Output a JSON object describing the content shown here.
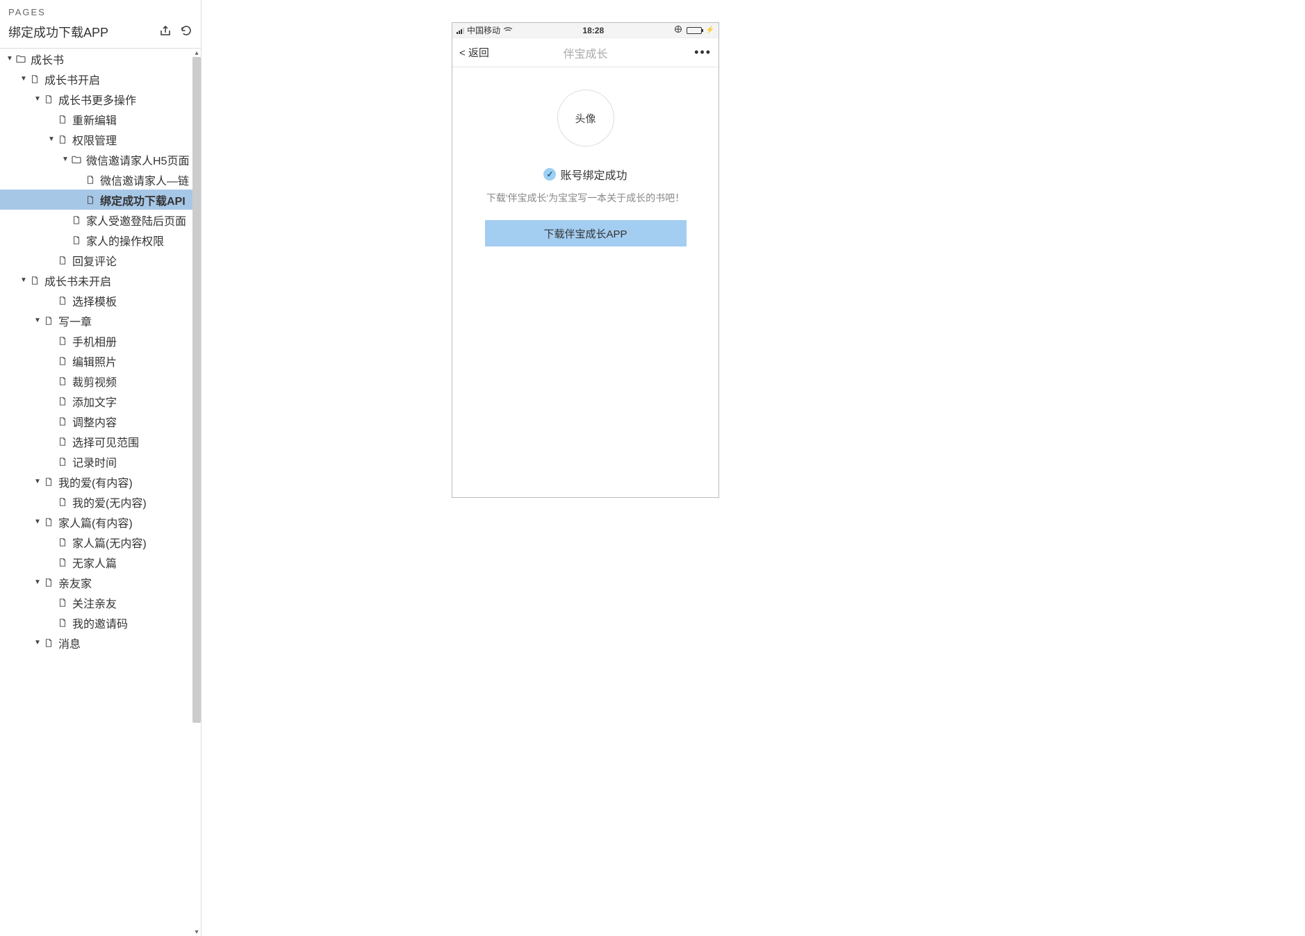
{
  "sidebar": {
    "header_label": "PAGES",
    "title": "绑定成功下载APP",
    "tree": [
      {
        "indent": 0,
        "chev": true,
        "icon": "folder",
        "label": "成长书"
      },
      {
        "indent": 1,
        "chev": true,
        "icon": "page",
        "label": "成长书开启"
      },
      {
        "indent": 2,
        "chev": true,
        "icon": "page",
        "label": "成长书更多操作"
      },
      {
        "indent": 3,
        "chev": false,
        "icon": "page",
        "label": "重新编辑"
      },
      {
        "indent": 3,
        "chev": true,
        "icon": "page",
        "label": "权限管理"
      },
      {
        "indent": 4,
        "chev": true,
        "icon": "folder",
        "label": "微信邀请家人H5页面"
      },
      {
        "indent": 5,
        "chev": false,
        "icon": "page",
        "label": "微信邀请家人—链"
      },
      {
        "indent": 5,
        "chev": false,
        "icon": "page",
        "label": "绑定成功下载API",
        "selected": true
      },
      {
        "indent": 4,
        "chev": false,
        "icon": "page",
        "label": "家人受邀登陆后页面"
      },
      {
        "indent": 4,
        "chev": false,
        "icon": "page",
        "label": "家人的操作权限"
      },
      {
        "indent": 3,
        "chev": false,
        "icon": "page",
        "label": "回复评论"
      },
      {
        "indent": 1,
        "chev": true,
        "icon": "page",
        "label": "成长书未开启"
      },
      {
        "indent": 3,
        "chev": false,
        "icon": "page",
        "label": "选择模板"
      },
      {
        "indent": 2,
        "chev": true,
        "icon": "page",
        "label": "写一章"
      },
      {
        "indent": 3,
        "chev": false,
        "icon": "page",
        "label": "手机相册"
      },
      {
        "indent": 3,
        "chev": false,
        "icon": "page",
        "label": "编辑照片"
      },
      {
        "indent": 3,
        "chev": false,
        "icon": "page",
        "label": "裁剪视频"
      },
      {
        "indent": 3,
        "chev": false,
        "icon": "page",
        "label": "添加文字"
      },
      {
        "indent": 3,
        "chev": false,
        "icon": "page",
        "label": "调整内容"
      },
      {
        "indent": 3,
        "chev": false,
        "icon": "page",
        "label": "选择可见范围"
      },
      {
        "indent": 3,
        "chev": false,
        "icon": "page",
        "label": "记录时间"
      },
      {
        "indent": 2,
        "chev": true,
        "icon": "page",
        "label": "我的爱(有内容)"
      },
      {
        "indent": 3,
        "chev": false,
        "icon": "page",
        "label": "我的爱(无内容)"
      },
      {
        "indent": 2,
        "chev": true,
        "icon": "page",
        "label": "家人篇(有内容)"
      },
      {
        "indent": 3,
        "chev": false,
        "icon": "page",
        "label": "家人篇(无内容)"
      },
      {
        "indent": 3,
        "chev": false,
        "icon": "page",
        "label": "无家人篇"
      },
      {
        "indent": 2,
        "chev": true,
        "icon": "page",
        "label": "亲友家"
      },
      {
        "indent": 3,
        "chev": false,
        "icon": "page",
        "label": "关注亲友"
      },
      {
        "indent": 3,
        "chev": false,
        "icon": "page",
        "label": "我的邀请码"
      },
      {
        "indent": 2,
        "chev": true,
        "icon": "page",
        "label": "消息"
      }
    ]
  },
  "phone": {
    "status": {
      "carrier": "中国移动",
      "time": "18:28"
    },
    "nav": {
      "back": "< 返回",
      "title": "伴宝成长"
    },
    "avatar_text": "头像",
    "success_text": "账号绑定成功",
    "sub_text": "下载'伴宝成长'为宝宝写一本关于成长的书吧！",
    "download_btn": "下载伴宝成长APP"
  }
}
